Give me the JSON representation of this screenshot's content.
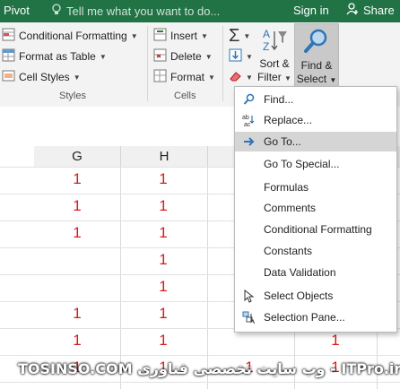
{
  "title_bar": {
    "pivot_label": "Pivot",
    "tell_me_placeholder": "Tell me what you want to do...",
    "sign_in": "Sign in",
    "share": "Share"
  },
  "ribbon": {
    "styles": {
      "conditional_formatting": "Conditional Formatting",
      "format_as_table": "Format as Table",
      "cell_styles": "Cell Styles",
      "group_label": "Styles"
    },
    "cells": {
      "insert": "Insert",
      "delete": "Delete",
      "format": "Format",
      "group_label": "Cells"
    },
    "editing": {
      "sort_filter_line1": "Sort &",
      "sort_filter_line2": "Filter",
      "find_select_line1": "Find &",
      "find_select_line2": "Select"
    }
  },
  "sheet": {
    "columns": [
      "G",
      "H",
      ""
    ],
    "col_g_values": [
      "1",
      "1",
      "1",
      "",
      "",
      "1",
      "1",
      "1"
    ],
    "col_h_values": [
      "1",
      "1",
      "1",
      "1",
      "1",
      "1",
      "1",
      "1"
    ],
    "col_k_values": [
      "",
      "",
      "",
      "",
      "",
      "",
      "1",
      "1"
    ],
    "col_j_values": [
      "",
      "",
      "",
      "",
      "",
      "",
      "",
      "1"
    ]
  },
  "menu": {
    "items": [
      {
        "label": "Find...",
        "icon": "binoculars-icon"
      },
      {
        "label": "Replace...",
        "icon": "replace-icon"
      },
      {
        "label": "Go To...",
        "icon": "arrow-right-icon",
        "highlighted": true
      },
      {
        "label": "Go To Special...",
        "icon": ""
      },
      {
        "label": "Formulas",
        "icon": ""
      },
      {
        "label": "Comments",
        "icon": ""
      },
      {
        "label": "Conditional Formatting",
        "icon": ""
      },
      {
        "label": "Constants",
        "icon": ""
      },
      {
        "label": "Data Validation",
        "icon": ""
      },
      {
        "label": "Select Objects",
        "icon": "pointer-icon"
      },
      {
        "label": "Selection Pane...",
        "icon": "selection-pane-icon"
      }
    ]
  },
  "watermark": "TOSINSO.COM  وب سایت تخصصی فناوری - ITPro.ir",
  "colors": {
    "title_bar": "#217346",
    "ribbon": "#f3f3f3",
    "cell_text": "#d71a1a",
    "menu_highlight": "#d5d5d5"
  }
}
